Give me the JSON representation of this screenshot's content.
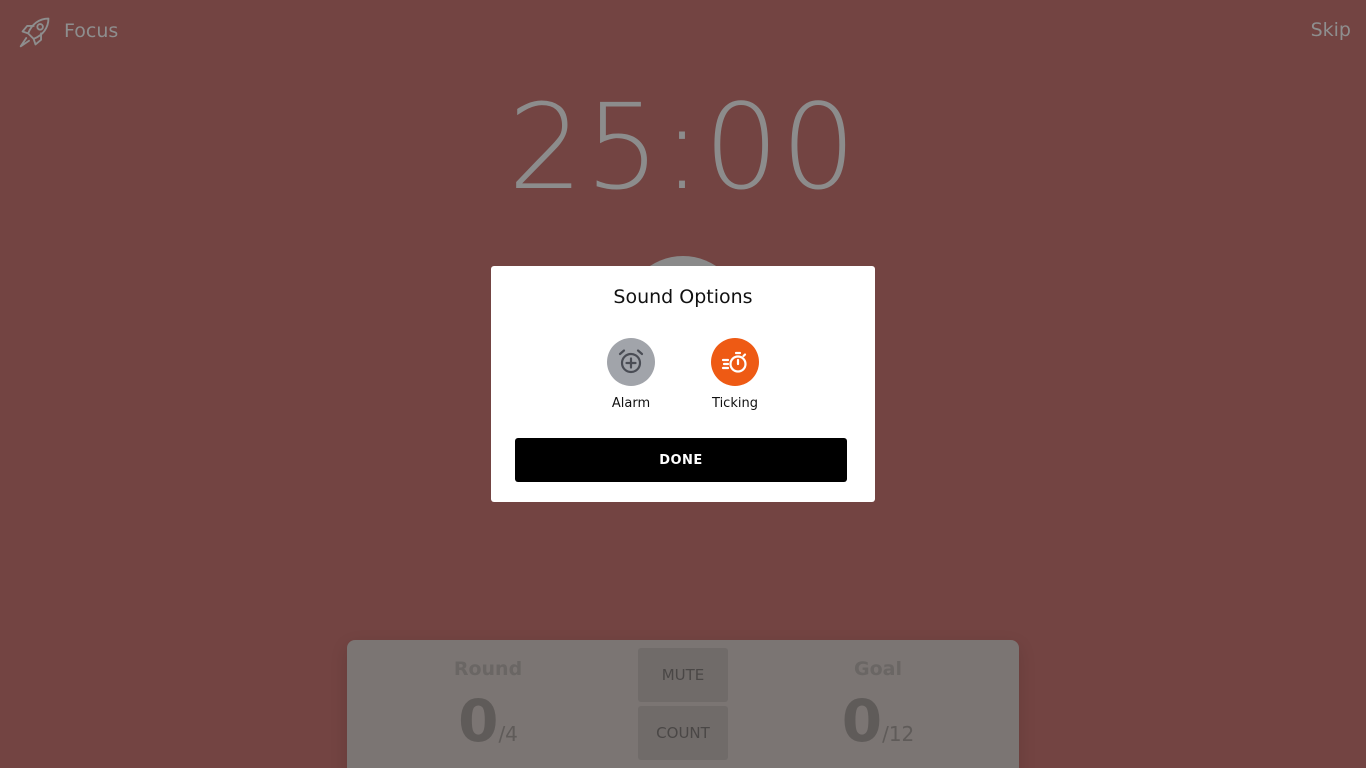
{
  "header": {
    "mode_label": "Focus",
    "skip_label": "Skip",
    "icon": "rocket-icon"
  },
  "timer": {
    "display": "25:00"
  },
  "modal": {
    "title": "Sound Options",
    "options": [
      {
        "label": "Alarm",
        "icon": "alarm-add-icon",
        "active": false,
        "color": "#a1a4aa"
      },
      {
        "label": "Ticking",
        "icon": "timer-ticking-icon",
        "active": true,
        "color": "#ee5a14"
      }
    ],
    "done_label": "DONE"
  },
  "panel": {
    "round": {
      "title": "Round",
      "value": "0",
      "total": "/4"
    },
    "goal": {
      "title": "Goal",
      "value": "0",
      "total": "/12"
    },
    "mute_label": "MUTE",
    "count_label": "COUNT"
  },
  "colors": {
    "background": "#734442",
    "accent": "#ee5a14",
    "inactive": "#a1a4aa"
  }
}
